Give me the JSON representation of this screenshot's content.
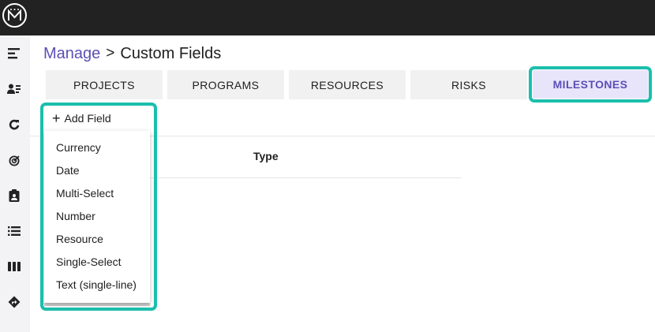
{
  "breadcrumb": {
    "parent": "Manage",
    "separator": ">",
    "current": "Custom Fields"
  },
  "tabs": [
    {
      "label": "PROJECTS",
      "active": false
    },
    {
      "label": "PROGRAMS",
      "active": false
    },
    {
      "label": "RESOURCES",
      "active": false
    },
    {
      "label": "RISKS",
      "active": false
    },
    {
      "label": "MILESTONES",
      "active": true
    }
  ],
  "toolbar": {
    "add_icon": "+",
    "add_field_label": "Add Field"
  },
  "table": {
    "columns": [
      "Type"
    ]
  },
  "field_type_menu": {
    "items": [
      "Currency",
      "Date",
      "Multi-Select",
      "Number",
      "Resource",
      "Single-Select",
      "Text (single-line)"
    ]
  },
  "sidebar": {
    "icons": [
      "menu-collapse-icon",
      "user-list-icon",
      "refresh-icon",
      "target-icon",
      "clipboard-user-icon",
      "list-icon",
      "board-columns-icon",
      "direction-sign-icon"
    ]
  },
  "colors": {
    "accent": "#5b4fb5",
    "highlight": "#1bbfac",
    "topbar": "#222222"
  }
}
